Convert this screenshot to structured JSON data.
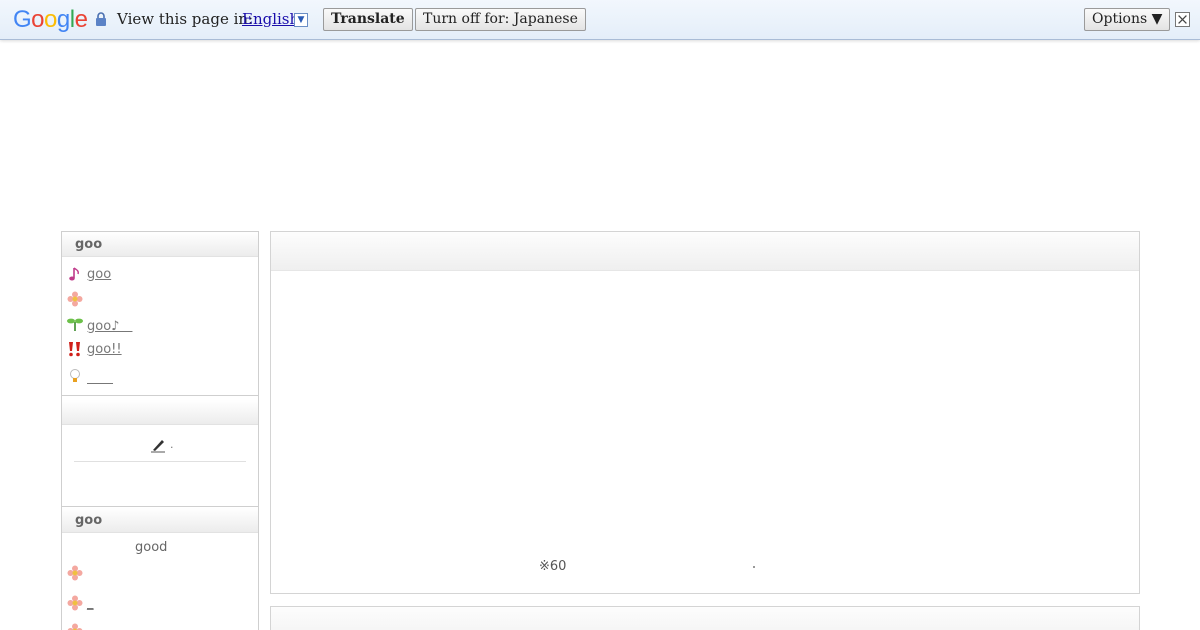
{
  "translate_bar": {
    "logo_letters": [
      "G",
      "o",
      "o",
      "g",
      "l",
      "e"
    ],
    "logo_colors": [
      "#4285f4",
      "#ea4335",
      "#fbbc05",
      "#4285f4",
      "#34a853",
      "#ea4335"
    ],
    "view_text": "View this page in:",
    "language": "English",
    "dropdown_glyph": "▼",
    "translate_label": "Translate",
    "turn_off_label": "Turn off for: Japanese",
    "options_label": "Options ▼",
    "close_glyph": "✕"
  },
  "sidebar": {
    "section1_title": "goo",
    "menu": [
      {
        "icon": "music-note-icon",
        "label": "goo"
      },
      {
        "icon": "flower-icon",
        "label": ""
      },
      {
        "icon": "sprout-icon",
        "label": "goo♪　"
      },
      {
        "icon": "exclamation-icon",
        "label": "goo!! "
      },
      {
        "icon": "bulb-icon",
        "label": "　　"
      }
    ],
    "section2_title": "",
    "pen_text": ".",
    "section3_title": "goo",
    "good_text": "good",
    "section3_items": [
      {
        "icon": "flower-icon",
        "label": ""
      },
      {
        "icon": "flower-icon",
        "label": "_"
      }
    ]
  },
  "main": {
    "note": "※60"
  }
}
